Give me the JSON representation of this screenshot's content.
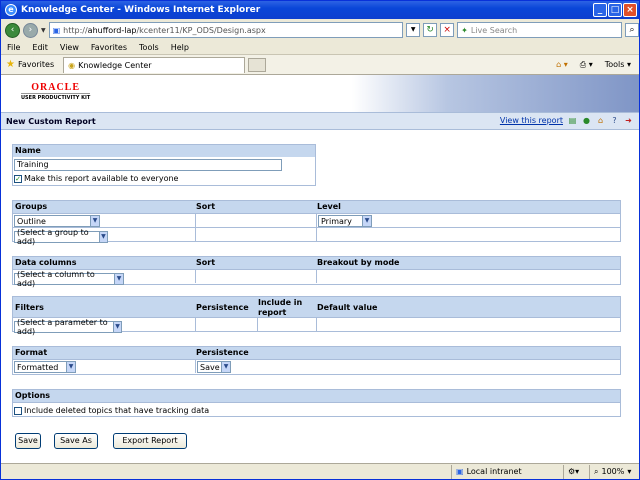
{
  "window": {
    "title": "Knowledge Center - Windows Internet Explorer"
  },
  "address": {
    "url_prefix": "http://",
    "host": "ahufford-lap",
    "path": "/kcenter11/KP_ODS/Design.aspx",
    "search_placeholder": "Live Search"
  },
  "menu": [
    "File",
    "Edit",
    "View",
    "Favorites",
    "Tools",
    "Help"
  ],
  "favorites": {
    "label": "Favorites",
    "tab": "Knowledge Center",
    "tools": "Tools"
  },
  "logo": {
    "brand": "ORACLE",
    "product": "USER PRODUCTIVITY KIT"
  },
  "page": {
    "title": "New Custom Report",
    "view_link": "View this report"
  },
  "name_section": {
    "header": "Name",
    "value": "Training",
    "share_label": "Make this report available to everyone"
  },
  "groups_section": {
    "headers": [
      "Groups",
      "Sort",
      "Level"
    ],
    "group_value": "Outline",
    "group_add": "(Select a group to add)",
    "level_value": "Primary"
  },
  "data_section": {
    "headers": [
      "Data columns",
      "Sort",
      "Breakout by mode"
    ],
    "column_add": "(Select a column to add)"
  },
  "filters_section": {
    "headers": [
      "Filters",
      "Persistence",
      "Include in report",
      "Default value"
    ],
    "param_add": "(Select a parameter to add)"
  },
  "format_section": {
    "headers": [
      "Format",
      "Persistence"
    ],
    "format_value": "Formatted",
    "persistence_value": "Save"
  },
  "options_section": {
    "header": "Options",
    "deleted_label": "Include deleted topics that have tracking data"
  },
  "buttons": {
    "save": "Save",
    "save_as": "Save As",
    "export": "Export Report"
  },
  "status": {
    "zone": "Local intranet",
    "zoom": "100%"
  }
}
